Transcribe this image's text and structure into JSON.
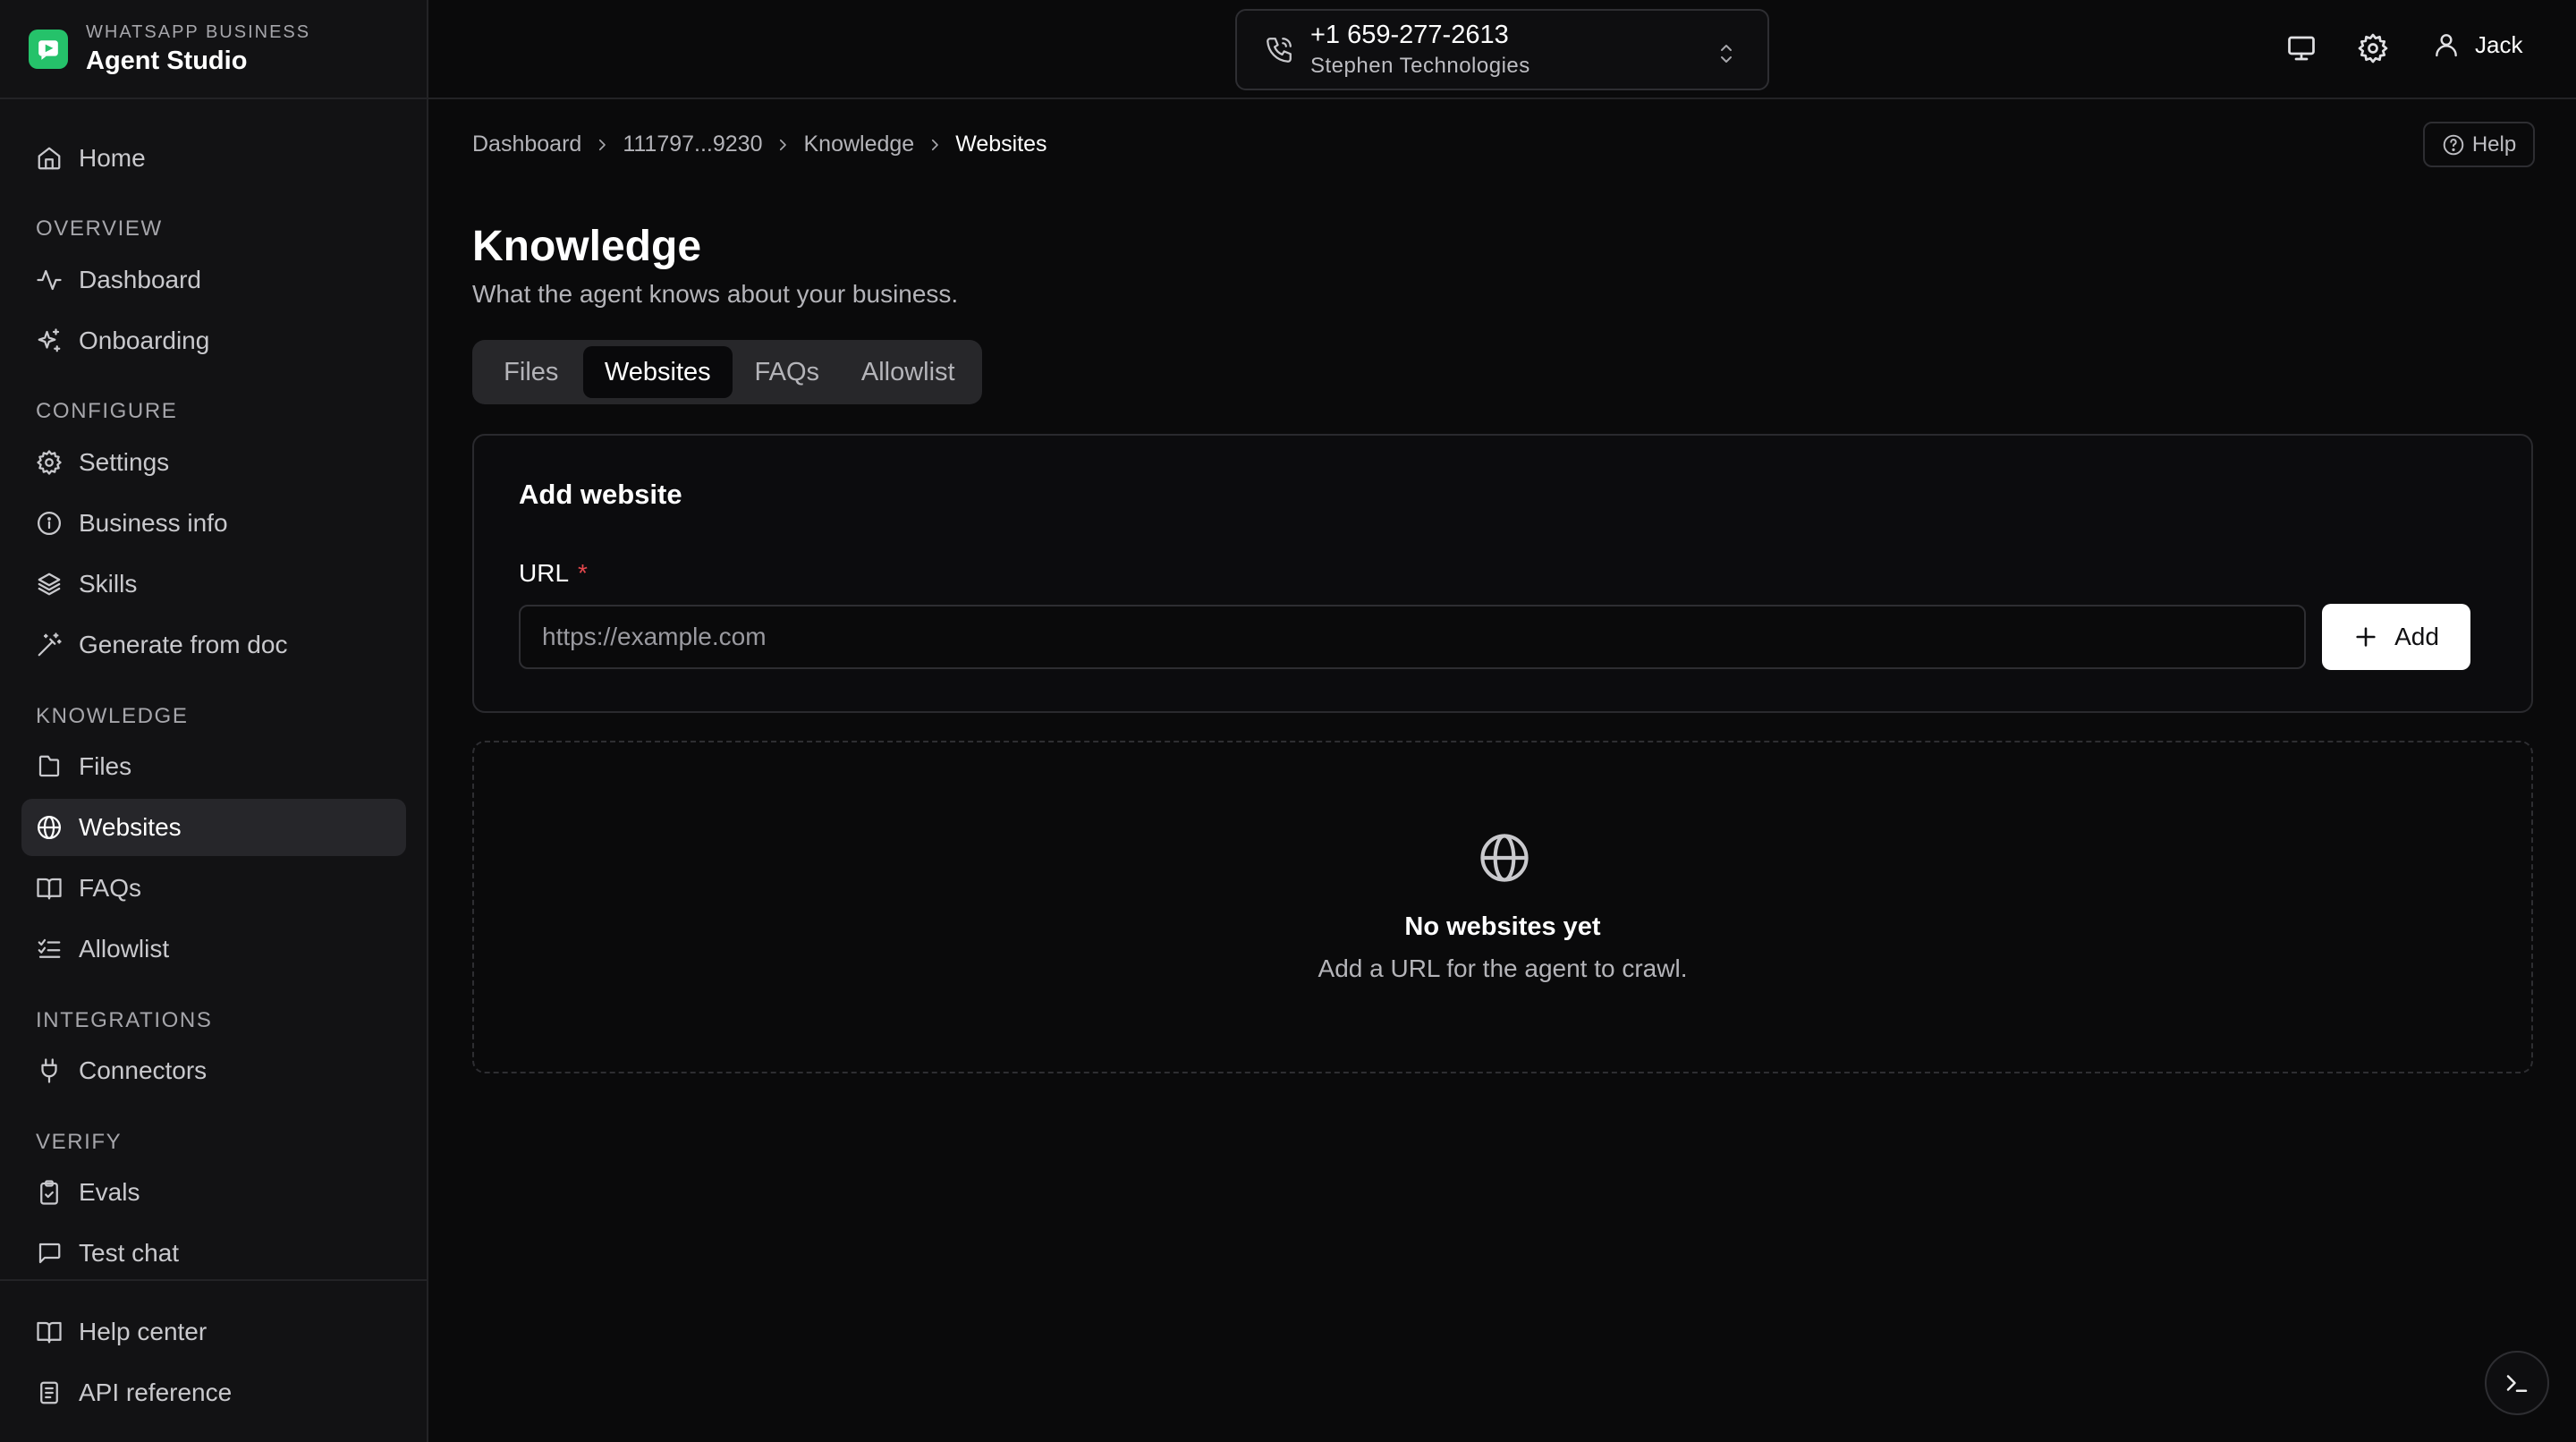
{
  "brand": {
    "subtitle": "WHATSAPP BUSINESS",
    "title": "Agent Studio"
  },
  "sidebar": {
    "home": "Home",
    "sections": {
      "overview": "OVERVIEW",
      "configure": "CONFIGURE",
      "knowledge": "KNOWLEDGE",
      "integrations": "INTEGRATIONS",
      "verify": "VERIFY"
    },
    "items": {
      "dashboard": "Dashboard",
      "onboarding": "Onboarding",
      "settings": "Settings",
      "business_info": "Business info",
      "skills": "Skills",
      "generate_from_doc": "Generate from doc",
      "files": "Files",
      "websites": "Websites",
      "faqs": "FAQs",
      "allowlist": "Allowlist",
      "connectors": "Connectors",
      "evals": "Evals",
      "test_chat": "Test chat"
    },
    "footer": {
      "help_center": "Help center",
      "api_reference": "API reference"
    },
    "active": "websites"
  },
  "header": {
    "phone_number": "+1 659-277-2613",
    "company": "Stephen Technologies",
    "user_name": "Jack"
  },
  "breadcrumb": [
    "Dashboard",
    "111797...9230",
    "Knowledge",
    "Websites"
  ],
  "help_label": "Help",
  "page": {
    "title": "Knowledge",
    "subtitle": "What the agent knows about your business."
  },
  "tabs": [
    "Files",
    "Websites",
    "FAQs",
    "Allowlist"
  ],
  "active_tab": "Websites",
  "add_website": {
    "title": "Add website",
    "url_label": "URL",
    "required_mark": "*",
    "url_value": "",
    "url_placeholder": "https://example.com",
    "add_label": "Add"
  },
  "empty_state": {
    "title": "No websites yet",
    "subtitle": "Add a URL for the agent to crawl."
  },
  "colors": {
    "accent_green": "#25c26a",
    "required_red": "#e5484d",
    "background": "#0a0a0b",
    "sidebar": "#121214"
  },
  "icons": {
    "brand": "whatsapp-business-logo",
    "home": "home-icon",
    "dashboard": "activity-icon",
    "onboarding": "sparkles-icon",
    "settings": "gear-icon",
    "business_info": "info-icon",
    "skills": "layers-icon",
    "generate_from_doc": "magic-wand-icon",
    "files": "file-icon",
    "websites": "globe-icon",
    "faqs": "book-icon",
    "allowlist": "list-checks-icon",
    "connectors": "plug-icon",
    "evals": "clipboard-check-icon",
    "test_chat": "message-square-icon",
    "help_center": "book-icon",
    "api_reference": "document-icon",
    "phone": "phone-icon",
    "chevrons": "chevrons-up-down-icon",
    "monitor": "monitor-icon",
    "header_settings": "gear-icon",
    "user": "user-icon",
    "help": "help-circle-icon",
    "add": "plus-icon",
    "empty": "globe-icon",
    "terminal": "terminal-icon"
  }
}
